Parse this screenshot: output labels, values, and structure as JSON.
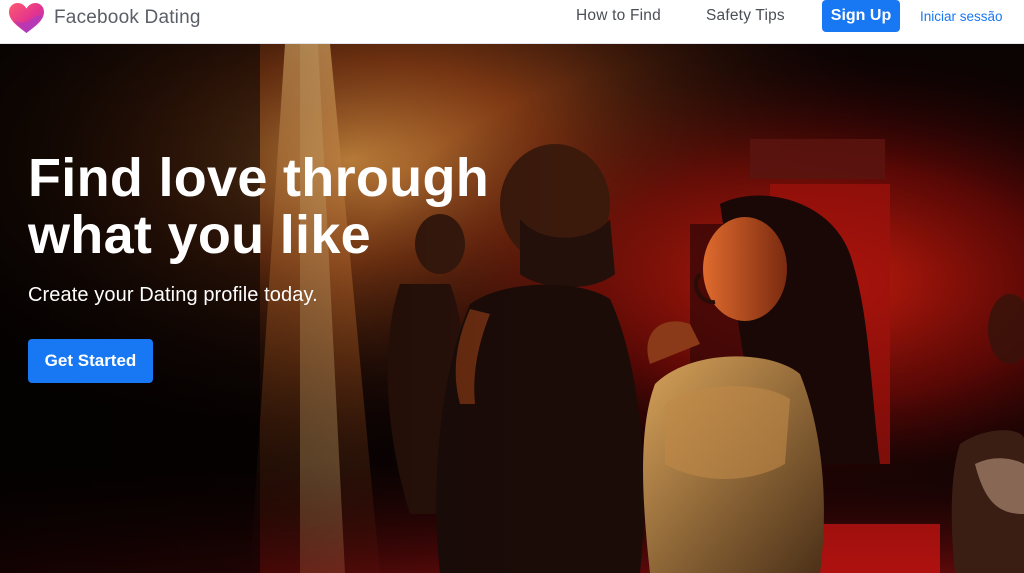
{
  "nav": {
    "brand_name": "Facebook Dating",
    "logo_icon": "heart-logo-icon",
    "links": {
      "how_to_find": "How to Find",
      "safety_tips": "Safety Tips"
    },
    "signup_label": "Sign Up",
    "login_label": "Iniciar sessão"
  },
  "hero": {
    "headline": "Find love through what you like",
    "subhead": "Create your Dating profile today.",
    "cta_label": "Get Started",
    "photo_description_icon": "dancing-couple-photo"
  },
  "colors": {
    "accent": "#1877f2",
    "logo_pink": "#f74a77",
    "logo_purple": "#9b3fd4",
    "nav_text": "#4b4f56",
    "hero_warm": "#d9541e",
    "hero_red": "#c4170f"
  }
}
